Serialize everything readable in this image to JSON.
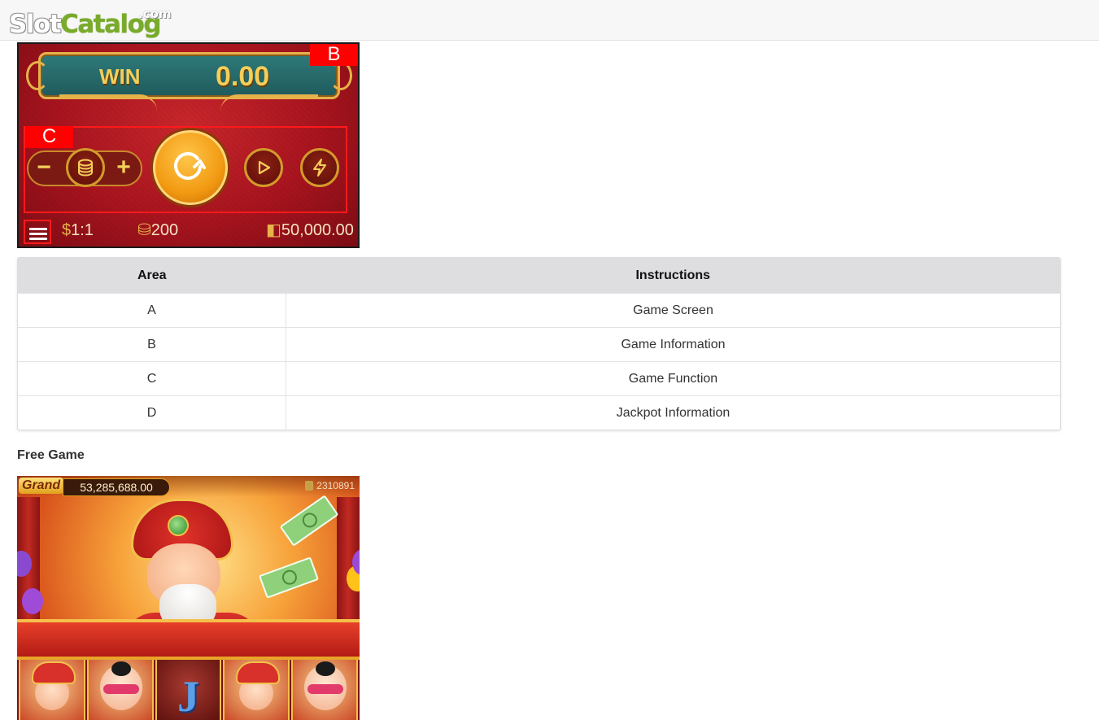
{
  "site": {
    "logo_part1": "Slot",
    "logo_part2": "Catalog",
    "logo_suffix": ".com"
  },
  "game_panel": {
    "win_label": "WIN",
    "win_value": "0.00",
    "area_tag_b": "B",
    "area_tag_c": "C",
    "rate_text": "1:1",
    "coins_text": "200",
    "balance_text": "50,000.00",
    "icons": [
      "menu-icon",
      "minus-icon",
      "coin-stack-icon",
      "plus-icon",
      "spin-icon",
      "play-icon",
      "lightning-icon",
      "dollar-icon",
      "coins-icon",
      "wallet-icon"
    ]
  },
  "table": {
    "headers": {
      "area": "Area",
      "instructions": "Instructions"
    },
    "rows": [
      {
        "area": "A",
        "instructions": "Game Screen"
      },
      {
        "area": "B",
        "instructions": "Game Information"
      },
      {
        "area": "C",
        "instructions": "Game Function"
      },
      {
        "area": "D",
        "instructions": "Jackpot Information"
      }
    ]
  },
  "free_game": {
    "section_title": "Free Game",
    "grand_label": "Grand",
    "grand_value": "53,285,688.00",
    "player_id": "2310891",
    "reel_symbol_j": "J"
  },
  "colors": {
    "logo_green": "#79ab2b",
    "panel_red": "#b8171f",
    "accent_gold": "#e6b24a",
    "area_tag_red": "#ff0000",
    "table_header_bg": "#dedde0"
  }
}
